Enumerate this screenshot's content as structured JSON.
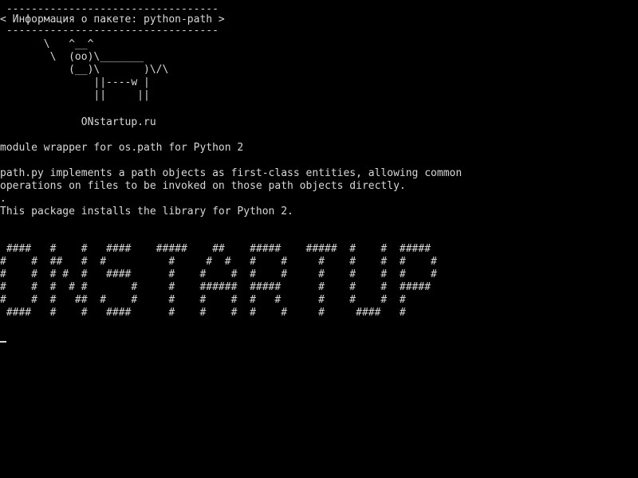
{
  "terminal": {
    "cowsay": {
      "top_border": " ----------------------------------",
      "bubble_text": "< Информация о пакете: python-path >",
      "bottom_border": " ----------------------------------",
      "cow_art": "       \\   ^__^\n        \\  (oo)\\_______\n           (__)\\       )\\/\\\n               ||----w |\n               ||     ||"
    },
    "site": "             ONstartup.ru",
    "package_summary": "module wrapper for os.path for Python 2",
    "description_line_1": "path.py implements a path objects as first-class entities, allowing common",
    "description_line_2": "operations on files to be invoked on those path objects directly.",
    "description_dot": ".",
    "description_line_3": "This package installs the library for Python 2.",
    "banner": " ####   #    #   ####    #####    ##    #####    #####  #    #  #####\n#    #  ##   #  #          #     #  #   #    #     #    #    #  #    #\n#    #  # #  #   ####      #    #    #  #    #     #    #    #  #    #\n#    #  #  # #       #     #    ######  #####      #    #    #  #####\n#    #  #   ##  #    #     #    #    #  #   #      #    #    #  #\n ####   #    #   ####      #    #    #  #    #     #     ####   #"
  },
  "colors": {
    "background": "#000000",
    "foreground": "#d8d8d8"
  }
}
